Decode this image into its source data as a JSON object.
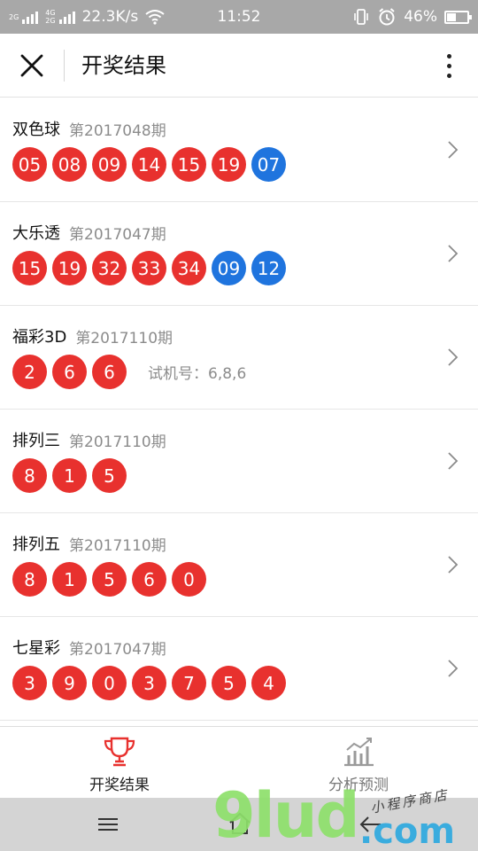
{
  "status_bar": {
    "net_left_top": "2G",
    "net_mid_top": "4G",
    "net_mid_bottom": "2G",
    "speed": "22.3K/s",
    "time": "11:52",
    "battery": "46%",
    "battery_level": 0.46,
    "icons": [
      "signal-icon",
      "wifi-icon",
      "vibrate-icon",
      "alarm-icon",
      "battery-icon"
    ]
  },
  "header": {
    "title": "开奖结果",
    "icons": [
      "close-icon",
      "more-vertical-icon"
    ]
  },
  "results": [
    {
      "name": "双色球",
      "issue": "第2017048期",
      "balls": [
        {
          "n": "05",
          "c": "red"
        },
        {
          "n": "08",
          "c": "red"
        },
        {
          "n": "09",
          "c": "red"
        },
        {
          "n": "14",
          "c": "red"
        },
        {
          "n": "15",
          "c": "red"
        },
        {
          "n": "19",
          "c": "red"
        },
        {
          "n": "07",
          "c": "blue"
        }
      ],
      "extra": ""
    },
    {
      "name": "大乐透",
      "issue": "第2017047期",
      "balls": [
        {
          "n": "15",
          "c": "red"
        },
        {
          "n": "19",
          "c": "red"
        },
        {
          "n": "32",
          "c": "red"
        },
        {
          "n": "33",
          "c": "red"
        },
        {
          "n": "34",
          "c": "red"
        },
        {
          "n": "09",
          "c": "blue"
        },
        {
          "n": "12",
          "c": "blue"
        }
      ],
      "extra": ""
    },
    {
      "name": "福彩3D",
      "issue": "第2017110期",
      "balls": [
        {
          "n": "2",
          "c": "red"
        },
        {
          "n": "6",
          "c": "red"
        },
        {
          "n": "6",
          "c": "red"
        }
      ],
      "extra": "试机号：6,8,6"
    },
    {
      "name": "排列三",
      "issue": "第2017110期",
      "balls": [
        {
          "n": "8",
          "c": "red"
        },
        {
          "n": "1",
          "c": "red"
        },
        {
          "n": "5",
          "c": "red"
        }
      ],
      "extra": ""
    },
    {
      "name": "排列五",
      "issue": "第2017110期",
      "balls": [
        {
          "n": "8",
          "c": "red"
        },
        {
          "n": "1",
          "c": "red"
        },
        {
          "n": "5",
          "c": "red"
        },
        {
          "n": "6",
          "c": "red"
        },
        {
          "n": "0",
          "c": "red"
        }
      ],
      "extra": ""
    },
    {
      "name": "七星彩",
      "issue": "第2017047期",
      "balls": [
        {
          "n": "3",
          "c": "red"
        },
        {
          "n": "9",
          "c": "red"
        },
        {
          "n": "0",
          "c": "red"
        },
        {
          "n": "3",
          "c": "red"
        },
        {
          "n": "7",
          "c": "red"
        },
        {
          "n": "5",
          "c": "red"
        },
        {
          "n": "4",
          "c": "red"
        }
      ],
      "extra": ""
    }
  ],
  "colors": {
    "ball_red": "#e8312e",
    "ball_blue": "#1f74de",
    "tab_active_icon": "#e8312e",
    "tab_inactive_icon": "#9a9a9a"
  },
  "tabs": [
    {
      "label": "开奖结果",
      "icon": "trophy-icon",
      "active": true
    },
    {
      "label": "分析预测",
      "icon": "chart-icon",
      "active": false
    }
  ],
  "nav_bar": {
    "icons": [
      "menu-icon",
      "home-icon",
      "back-icon"
    ]
  },
  "watermark": {
    "logo": "9lud",
    "domain": ".com",
    "tagline": "小程序商店"
  }
}
